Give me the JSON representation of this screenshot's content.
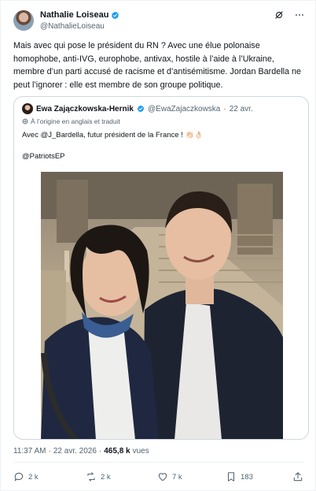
{
  "author": {
    "name": "Nathalie Loiseau",
    "handle": "@NathalieLoiseau"
  },
  "tweet_text": "Mais avec qui pose le président du RN ? Avec une élue polonaise homophobe, anti-IVG, europhobe, antivax, hostile à l’aide à l’Ukraine, membre d’un parti accusé de racisme et d’antisémitisme. Jordan Bardella ne peut l’ignorer : elle est membre de son groupe politique.",
  "quote": {
    "name": "Ewa Zajączkowska-Hernik",
    "handle": "@EwaZajaczkowska",
    "separator": "·",
    "date": "22 avr.",
    "translation_note": "À l’origine en anglais et traduit",
    "line1": "Avec @J_Bardella, futur président de la France !",
    "emoji": "👏🏻👌🏻",
    "line2": "@PatriotsEP"
  },
  "meta": {
    "time": "11:37 AM",
    "separator": "·",
    "date": "22 avr. 2026",
    "views_count": "465,8 k",
    "views_label": "vues"
  },
  "actions": {
    "replies": "2 k",
    "reposts": "2 k",
    "likes": "7 k",
    "bookmarks": "183"
  },
  "colors": {
    "verified": "#1d9bf0",
    "muted": "#536471",
    "border": "#cfd9de"
  },
  "icons": [
    "verified-badge-icon",
    "grok-icon",
    "more-icon",
    "translate-icon",
    "reply-icon",
    "repost-icon",
    "like-icon",
    "bookmark-icon",
    "share-icon"
  ]
}
